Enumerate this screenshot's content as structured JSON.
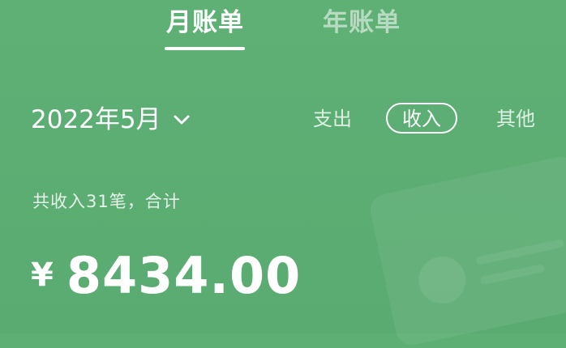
{
  "tabs": {
    "month": "月账单",
    "year": "年账单"
  },
  "period": {
    "label": "2022年5月",
    "icon": "chevron-down-icon"
  },
  "filters": {
    "expense": "支出",
    "income": "收入",
    "other": "其他",
    "selected": "收入"
  },
  "summary": {
    "text": "共收入31笔，合计",
    "currency": "¥",
    "amount": "8434.00"
  },
  "colors": {
    "background": "#5daf74",
    "text": "#ffffff"
  }
}
